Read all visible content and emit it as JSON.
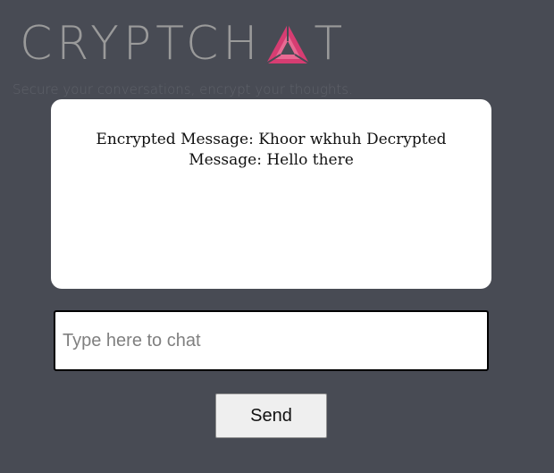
{
  "header": {
    "logo_left": "CRYPTCH",
    "logo_right": "T",
    "tagline": "Secure your conversations, encrypt your thoughts.",
    "logo_icon": "triangle-a-icon",
    "logo_text_color": "#9a9a9a",
    "logo_icon_color": "#d63d72"
  },
  "chat": {
    "messages": [
      "Encrypted Message: Khoor wkhuh Decrypted Message: Hello there"
    ]
  },
  "composer": {
    "placeholder": "Type here to chat",
    "value": "",
    "send_label": "Send"
  },
  "colors": {
    "background": "#484b54",
    "panel": "#ffffff"
  }
}
